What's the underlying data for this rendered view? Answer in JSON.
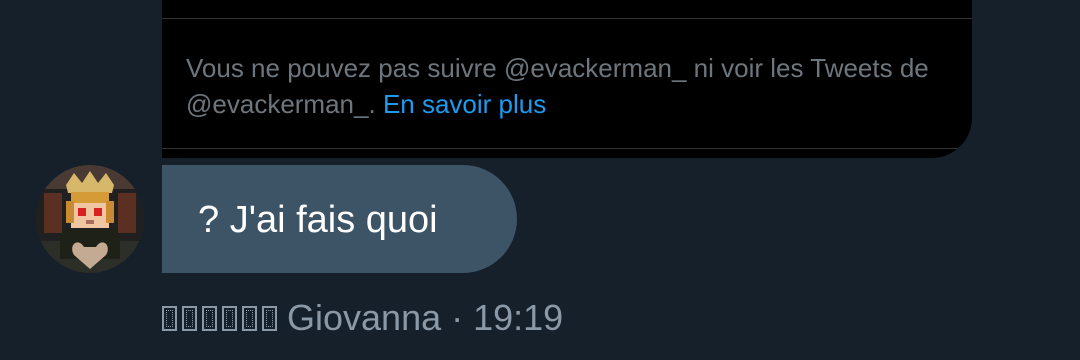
{
  "colors": {
    "background": "#15202b",
    "card_background": "#000000",
    "link": "#1d9bf0",
    "bubble": "#3d5466",
    "muted_text": "#8b98a5"
  },
  "quoted_tweet": {
    "notice_text": "Vous ne pouvez pas suivre @evackerman_ ni voir les Tweets de @evackerman_.",
    "link_text": "En savoir plus"
  },
  "message": {
    "avatar_icon": "user-avatar",
    "text": "? J'ai fais quoi",
    "sender_display_glyphs": "▯ ▯ ▯ ▯ ▯ ▯",
    "sender_name": "Giovanna",
    "separator": "·",
    "time": "19:19"
  }
}
